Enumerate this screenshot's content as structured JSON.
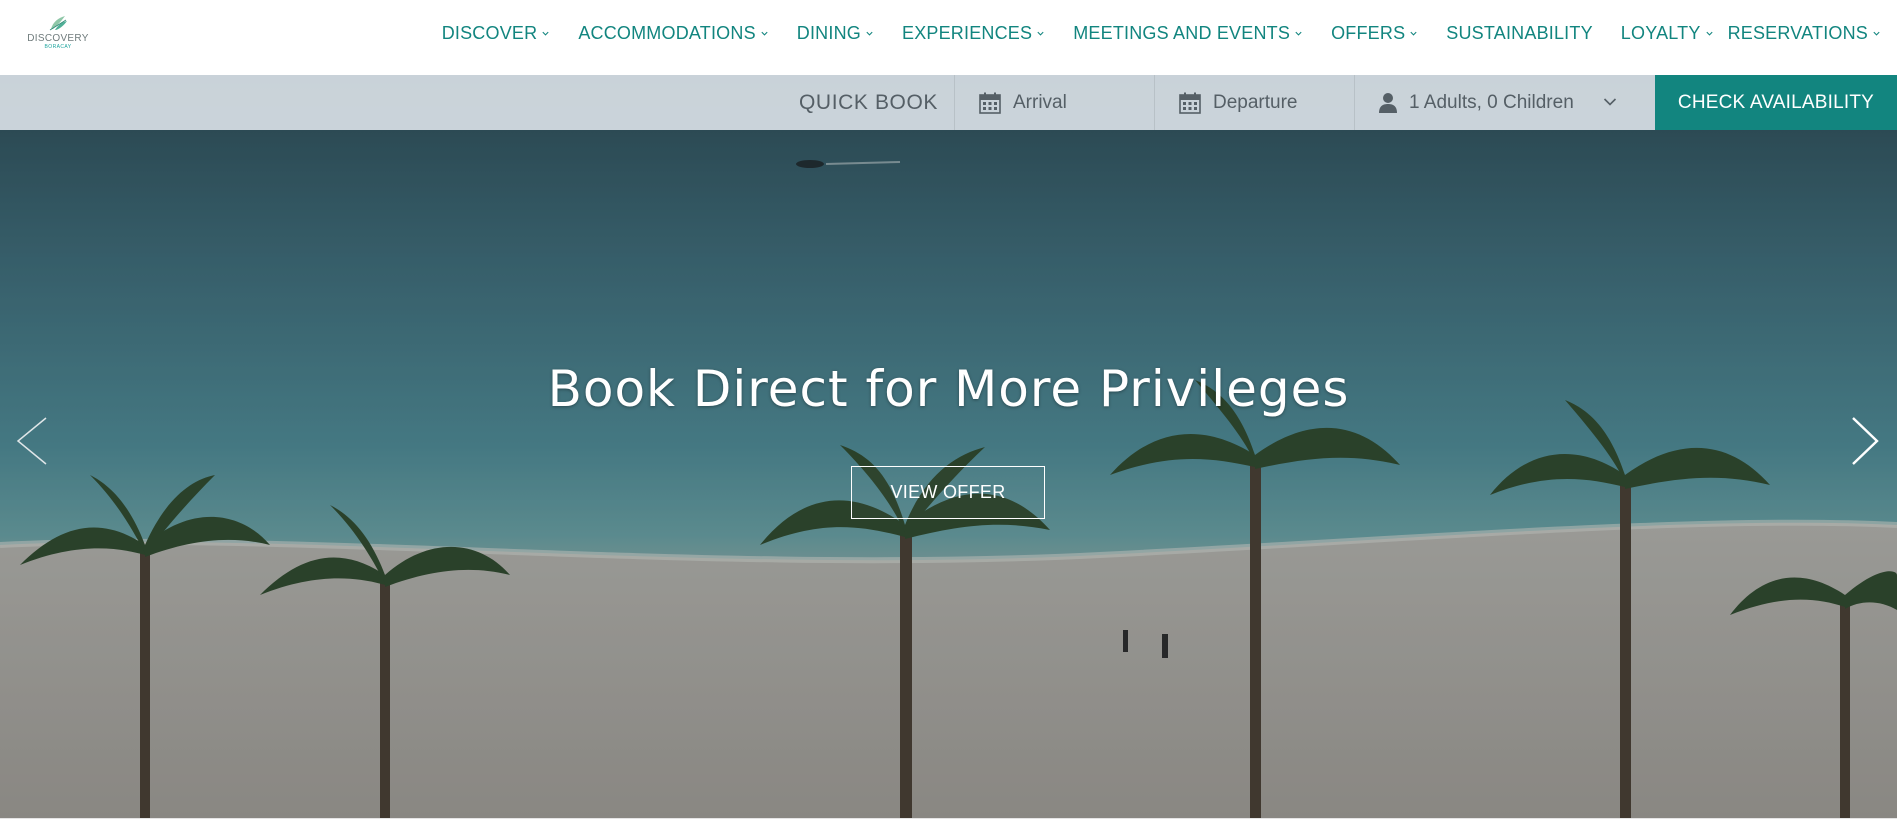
{
  "brand": {
    "name": "DISCOVERY",
    "sub": "BORACAY",
    "color": "#12857f"
  },
  "nav": {
    "items": [
      {
        "label": "DISCOVER",
        "icon": "chevron-down-icon"
      },
      {
        "label": "ACCOMMODATIONS",
        "icon": "chevron-down-icon"
      },
      {
        "label": "DINING",
        "icon": "chevron-down-icon"
      },
      {
        "label": "EXPERIENCES",
        "icon": "chevron-down-icon"
      },
      {
        "label": "MEETINGS AND EVENTS",
        "icon": "chevron-down-icon"
      },
      {
        "label": "OFFERS",
        "icon": "chevron-down-icon"
      },
      {
        "label": "SUSTAINABILITY",
        "icon": ""
      },
      {
        "label": "LOYALTY",
        "icon": "chevron-down-icon"
      },
      {
        "label": "RESERVATIONS",
        "icon": "chevron-down-icon"
      }
    ]
  },
  "quick_book": {
    "label": "QUICK BOOK",
    "arrival": "Arrival",
    "departure": "Departure",
    "guests": "1 Adults, 0 Children",
    "button": "CHECK AVAILABILITY",
    "icons": [
      "calendar-icon",
      "calendar-icon",
      "person-icon",
      "chevron-down-icon"
    ]
  },
  "hero": {
    "title": "Book Direct for More Privileges",
    "button": "VIEW OFFER",
    "prev_icon": "arrow-left-icon",
    "next_icon": "arrow-right-icon"
  }
}
